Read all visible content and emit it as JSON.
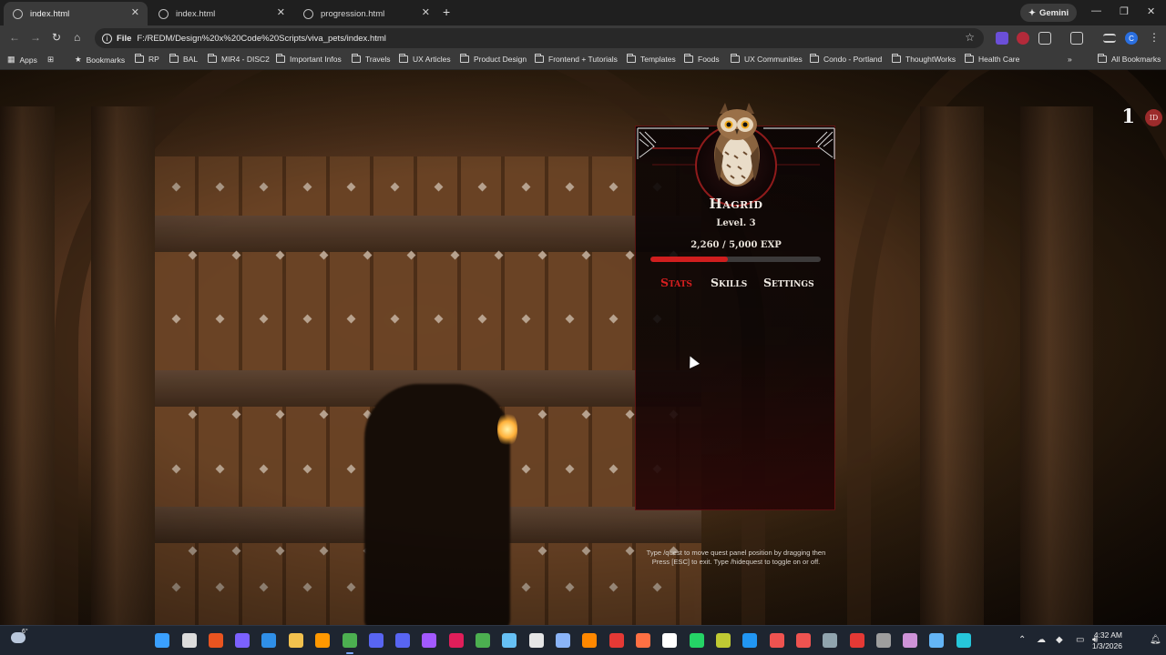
{
  "browser": {
    "tabs": [
      {
        "title": "index.html",
        "active": true
      },
      {
        "title": "index.html",
        "active": false
      },
      {
        "title": "progression.html",
        "active": false
      }
    ],
    "gemini_label": "Gemini",
    "address_scheme": "File",
    "address_url": "F:/REDM/Design%20x%20Code%20Scripts/viva_pets/index.html",
    "profile_initial": "C",
    "bookmarks": [
      "Apps",
      "Bookmarks",
      "RP",
      "BAL",
      "MIR4 - DISC2",
      "Important Infos",
      "Travels",
      "UX Articles",
      "Product Design",
      "Frontend + Tutorials",
      "Templates",
      "Foods",
      "UX Communities",
      "Condo - Portland",
      "ThoughtWorks",
      "Health Care"
    ],
    "all_bookmarks_label": "All Bookmarks"
  },
  "overlay": {
    "count": "1",
    "badge": "ID"
  },
  "pet": {
    "name": "Hagrid",
    "level_text": "Level. 3",
    "exp_text": "2,260 / 5,000 EXP",
    "exp_fraction": 0.452,
    "tabs": [
      {
        "label": "Stats",
        "active": true
      },
      {
        "label": "Skills",
        "active": false
      },
      {
        "label": "Settings",
        "active": false
      }
    ],
    "hint": "Type /quest to move quest panel position by dragging then Press [ESC] to exit. Type /hidequest to toggle on or off."
  },
  "taskbar": {
    "weather_temp": "6°",
    "time": "4:32 AM",
    "date": "1/3/2026",
    "notification_badge": "99+"
  },
  "colors": {
    "accent_red": "#d61f1f",
    "exp_fill": "#d01e1e",
    "panel_border": "#8f1b1b"
  }
}
